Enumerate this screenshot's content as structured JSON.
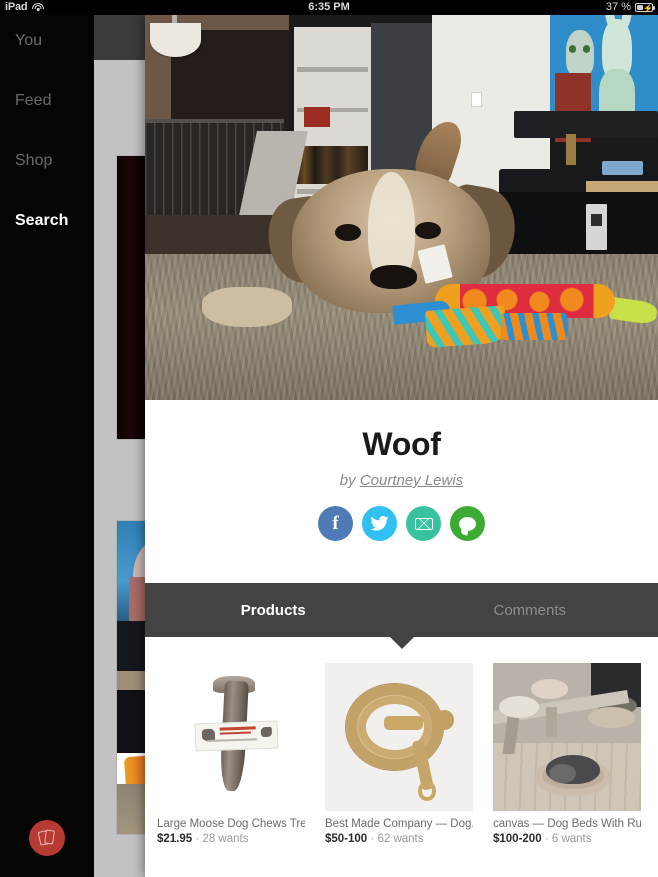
{
  "status_bar": {
    "device": "iPad",
    "wifi_icon": "wifi-icon",
    "time": "6:35 PM",
    "battery_percent": "37 %",
    "battery_icon": "battery-charging-icon"
  },
  "sidebar": {
    "items": [
      {
        "label": "You",
        "active": false
      },
      {
        "label": "Feed",
        "active": false
      },
      {
        "label": "Shop",
        "active": false
      },
      {
        "label": "Search",
        "active": true
      }
    ],
    "tab_button_icon": "cards-icon",
    "tab_button_color": "#b73b33"
  },
  "modal": {
    "hero_image_alt": "dog-lying-with-colorful-toy-photo",
    "title": "Woof",
    "byline_prefix": "by",
    "author": "Courtney Lewis",
    "share_buttons": [
      {
        "name": "facebook-share-button",
        "icon": "facebook-icon",
        "color": "#4e7ab5"
      },
      {
        "name": "twitter-share-button",
        "icon": "twitter-icon",
        "color": "#31c0f2"
      },
      {
        "name": "email-share-button",
        "icon": "envelope-icon",
        "color": "#38c2a0"
      },
      {
        "name": "message-share-button",
        "icon": "speech-bubble-icon",
        "color": "#3cab34"
      }
    ],
    "tabs": [
      {
        "label": "Products",
        "active": true
      },
      {
        "label": "Comments",
        "active": false
      }
    ],
    "products": [
      {
        "title": "Large Moose Dog Chews Treat...",
        "price": "$21.95",
        "separator": "·",
        "wants": "28 wants",
        "image_alt": "antler-dog-chew-photo"
      },
      {
        "title": "Best Made Company — Dog...",
        "price": "$50-100",
        "separator": "·",
        "wants": "62 wants",
        "image_alt": "coiled-rope-dog-leash-photo"
      },
      {
        "title": "canvas — Dog Beds With Runn...",
        "price": "$100-200",
        "separator": "·",
        "wants": "6 wants",
        "image_alt": "dog-sleeping-on-cushion-bed-photo"
      }
    ]
  }
}
